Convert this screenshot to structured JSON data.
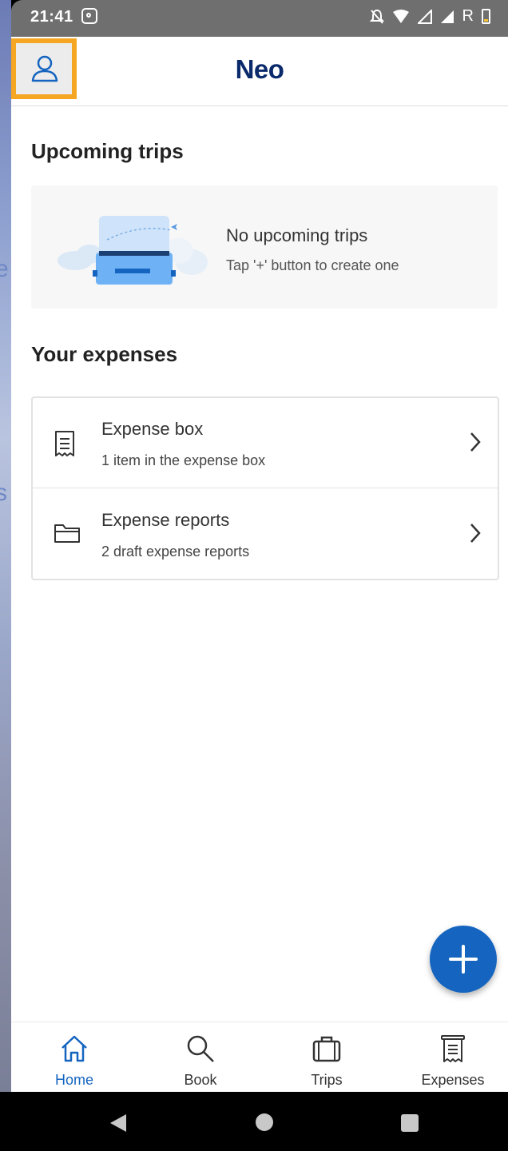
{
  "status_bar": {
    "time": "21:41",
    "carrier_letter": "R"
  },
  "header": {
    "title": "Neo",
    "profile_icon": "user-icon"
  },
  "upcoming_trips": {
    "title": "Upcoming trips",
    "empty_title": "No upcoming trips",
    "empty_hint": "Tap '+' button to create one"
  },
  "expenses": {
    "title": "Your expenses",
    "items": [
      {
        "label": "Expense box",
        "sub": "1 item in the expense box",
        "icon": "receipt-icon"
      },
      {
        "label": "Expense reports",
        "sub": "2 draft expense reports",
        "icon": "folder-icon"
      }
    ]
  },
  "fab": {
    "icon": "plus-icon"
  },
  "bottom_nav": [
    {
      "label": "Home",
      "icon": "home-icon",
      "active": true
    },
    {
      "label": "Book",
      "icon": "search-icon",
      "active": false
    },
    {
      "label": "Trips",
      "icon": "suitcase-icon",
      "active": false
    },
    {
      "label": "Expenses",
      "icon": "receipt-icon",
      "active": false
    }
  ],
  "colors": {
    "accent": "#1565c0",
    "brand_title": "#0a2a6b",
    "highlight": "#f5a623"
  }
}
